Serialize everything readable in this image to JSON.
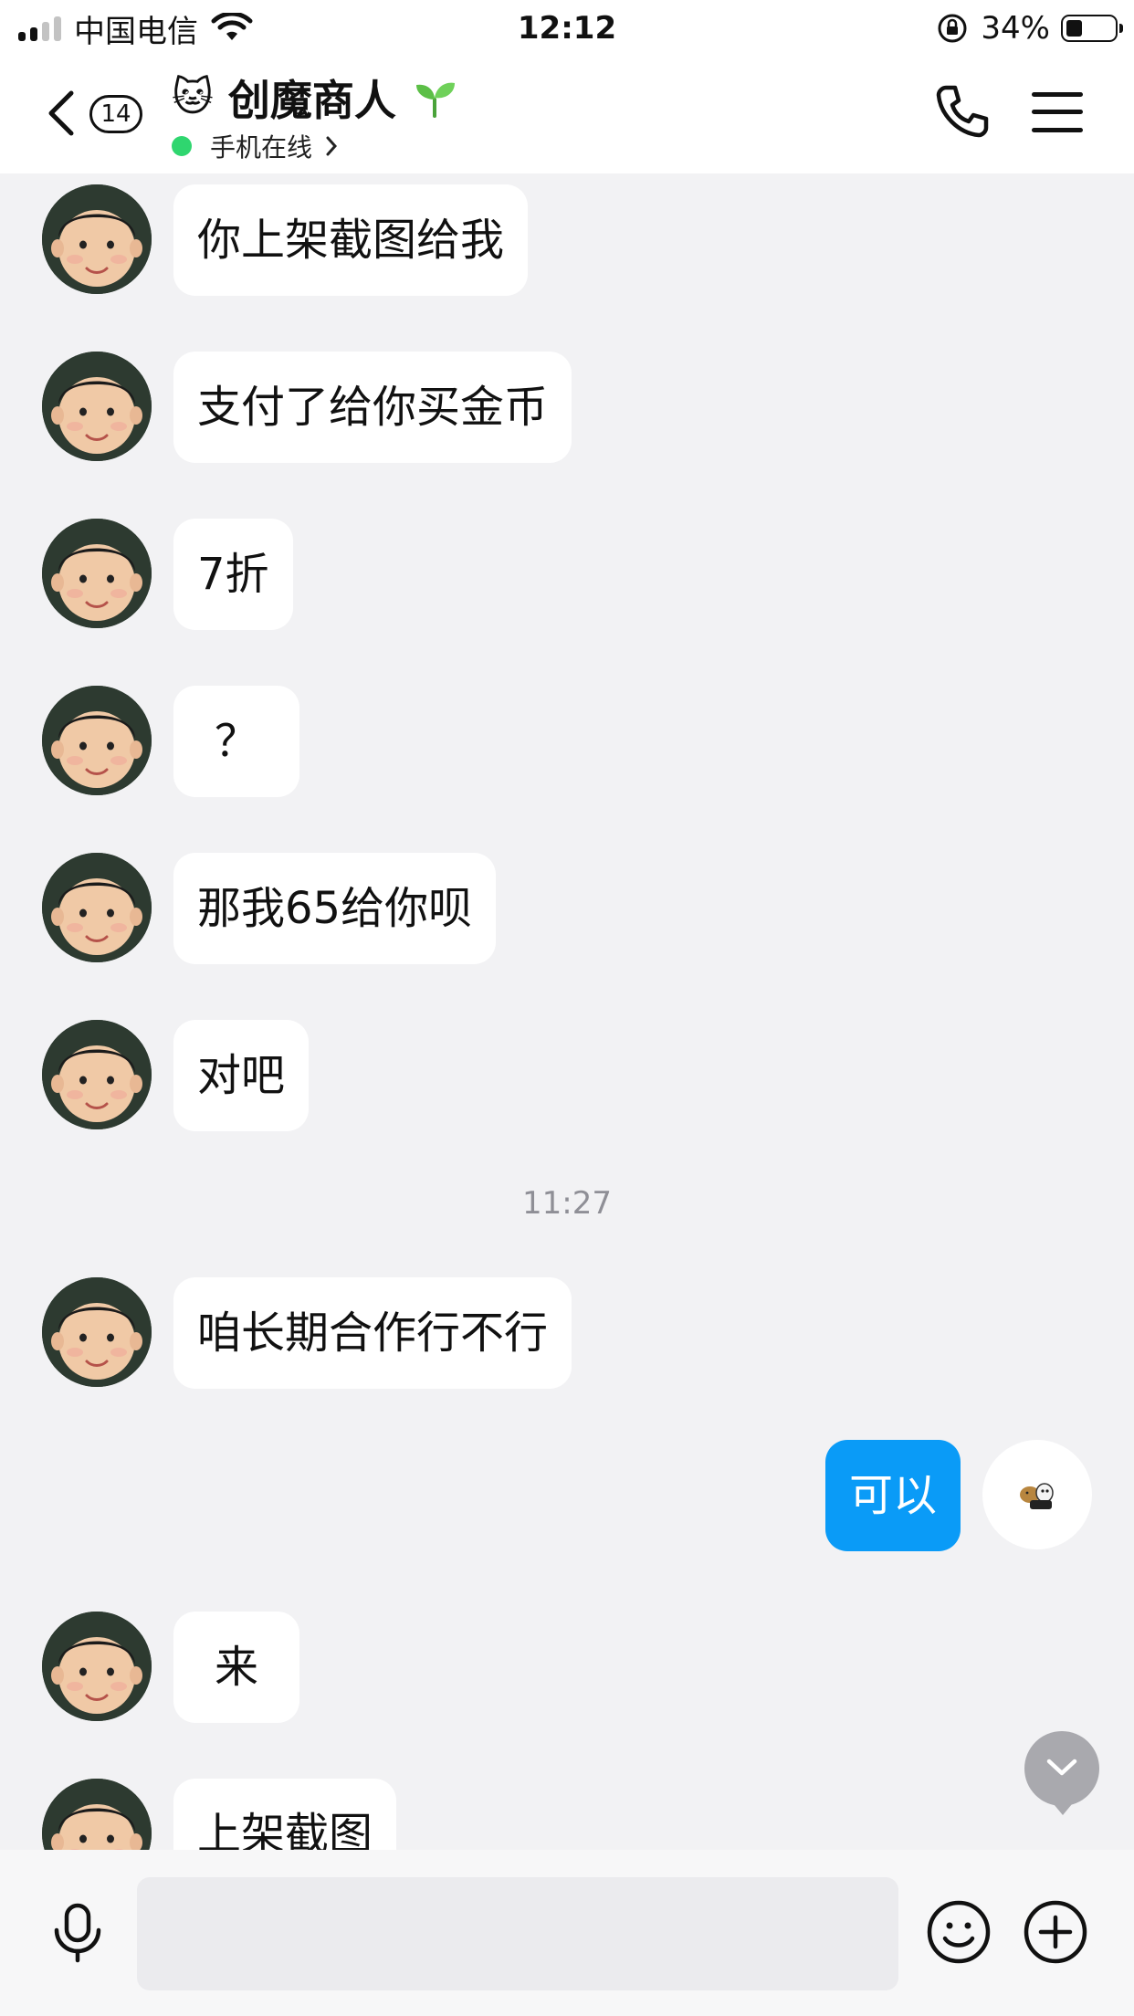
{
  "status_bar": {
    "carrier": "中国电信",
    "time": "12:12",
    "battery_percent": "34%",
    "battery_level": 0.34
  },
  "header": {
    "unread_count": "14",
    "contact_emoji": "🐱",
    "contact_name": "创魔商人",
    "presence": "手机在线",
    "icons": [
      "back-icon",
      "phone-icon",
      "menu-icon",
      "sprout-icon"
    ]
  },
  "messages": [
    {
      "text": "你上架截图给我"
    },
    {
      "text": "支付了给你买金币"
    },
    {
      "text": "7折"
    },
    {
      "text": "？"
    },
    {
      "text": "那我65给你呗"
    },
    {
      "text": "对吧"
    },
    {
      "timestamp": "11:27"
    },
    {
      "text": "咱长期合作行不行"
    },
    {
      "text": "可以"
    },
    {
      "text": "来"
    },
    {
      "text": "上架截图"
    }
  ],
  "input": {
    "placeholder": "",
    "icons": [
      "mic-icon",
      "emoji-icon",
      "plus-icon",
      "scroll-down-icon"
    ]
  },
  "colors": {
    "accent": "#0a9bf7",
    "online": "#2fd66f",
    "chat_bg": "#f2f2f4"
  }
}
